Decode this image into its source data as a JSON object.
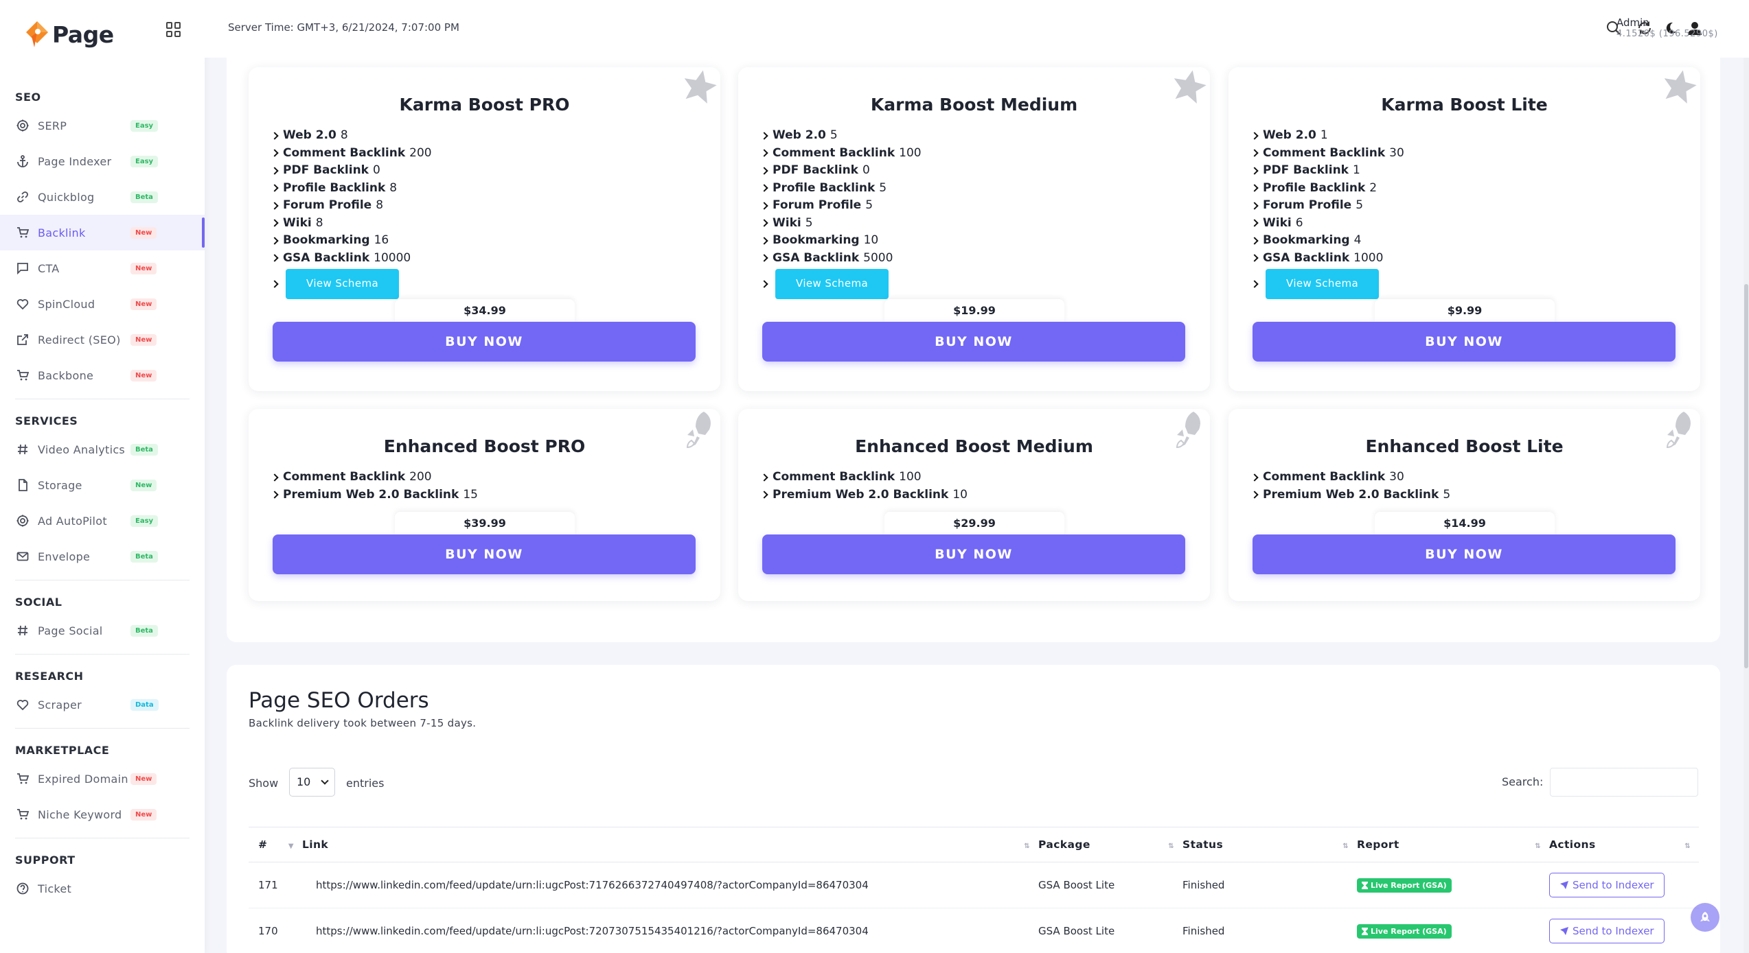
{
  "brand": {
    "name": "Page"
  },
  "header": {
    "server_time": "Server Time: GMT+3, 6/21/2024, 7:07:00 PM",
    "admin_name": "Admin",
    "admin_balance": "4.1520$ (196.5290$)"
  },
  "sidebar": {
    "sections": [
      {
        "title": "SEO",
        "items": [
          {
            "label": "SERP",
            "badge": "Easy",
            "badge_color": "green",
            "icon": "globe-icon"
          },
          {
            "label": "Page Indexer",
            "badge": "Easy",
            "badge_color": "green",
            "icon": "anchor-icon"
          },
          {
            "label": "Quickblog",
            "badge": "Beta",
            "badge_color": "green",
            "icon": "link-icon"
          },
          {
            "label": "Backlink",
            "badge": "New",
            "badge_color": "red",
            "icon": "cart-icon",
            "active": true
          },
          {
            "label": "CTA",
            "badge": "New",
            "badge_color": "red",
            "icon": "comment-icon"
          },
          {
            "label": "SpinCloud",
            "badge": "New",
            "badge_color": "red",
            "icon": "heart-icon"
          },
          {
            "label": "Redirect (SEO)",
            "badge": "New",
            "badge_color": "red",
            "icon": "external-link-icon"
          },
          {
            "label": "Backbone",
            "badge": "New",
            "badge_color": "red",
            "icon": "cart-icon"
          }
        ]
      },
      {
        "title": "SERVICES",
        "items": [
          {
            "label": "Video Analytics",
            "badge": "Beta",
            "badge_color": "green",
            "icon": "hash-icon"
          },
          {
            "label": "Storage",
            "badge": "New",
            "badge_color": "green",
            "icon": "file-icon"
          },
          {
            "label": "Ad AutoPilot",
            "badge": "Easy",
            "badge_color": "green",
            "icon": "globe-icon"
          },
          {
            "label": "Envelope",
            "badge": "Beta",
            "badge_color": "green",
            "icon": "mail-icon"
          }
        ]
      },
      {
        "title": "SOCIAL",
        "items": [
          {
            "label": "Page Social",
            "badge": "Beta",
            "badge_color": "green",
            "icon": "hash-icon"
          }
        ]
      },
      {
        "title": "RESEARCH",
        "items": [
          {
            "label": "Scraper",
            "badge": "Data",
            "badge_color": "blue",
            "icon": "heart-icon"
          }
        ]
      },
      {
        "title": "MARKETPLACE",
        "items": [
          {
            "label": "Expired Domain",
            "badge": "New",
            "badge_color": "red",
            "icon": "cart-icon"
          },
          {
            "label": "Niche Keyword",
            "badge": "New",
            "badge_color": "red",
            "icon": "cart-icon"
          }
        ]
      },
      {
        "title": "SUPPORT",
        "items": [
          {
            "label": "Ticket",
            "badge": "",
            "badge_color": "",
            "icon": "help-circle-icon"
          }
        ]
      }
    ]
  },
  "packages": [
    {
      "title": "Karma Boost PRO",
      "price": "$34.99",
      "schema": "View Schema",
      "corner": "star-icon",
      "features": [
        [
          "Web 2.0",
          "8"
        ],
        [
          "Comment Backlink",
          "200"
        ],
        [
          "PDF Backlink",
          "0"
        ],
        [
          "Profile Backlink",
          "8"
        ],
        [
          "Forum Profile",
          "8"
        ],
        [
          "Wiki",
          "8"
        ],
        [
          "Bookmarking",
          "16"
        ],
        [
          "GSA Backlink",
          "10000"
        ]
      ]
    },
    {
      "title": "Karma Boost Medium",
      "price": "$19.99",
      "schema": "View Schema",
      "corner": "star-icon",
      "features": [
        [
          "Web 2.0",
          "5"
        ],
        [
          "Comment Backlink",
          "100"
        ],
        [
          "PDF Backlink",
          "0"
        ],
        [
          "Profile Backlink",
          "5"
        ],
        [
          "Forum Profile",
          "5"
        ],
        [
          "Wiki",
          "5"
        ],
        [
          "Bookmarking",
          "10"
        ],
        [
          "GSA Backlink",
          "5000"
        ]
      ]
    },
    {
      "title": "Karma Boost Lite",
      "price": "$9.99",
      "schema": "View Schema",
      "corner": "star-icon",
      "features": [
        [
          "Web 2.0",
          "1"
        ],
        [
          "Comment Backlink",
          "30"
        ],
        [
          "PDF Backlink",
          "1"
        ],
        [
          "Profile Backlink",
          "2"
        ],
        [
          "Forum Profile",
          "5"
        ],
        [
          "Wiki",
          "6"
        ],
        [
          "Bookmarking",
          "4"
        ],
        [
          "GSA Backlink",
          "1000"
        ]
      ]
    },
    {
      "title": "Enhanced Boost PRO",
      "price": "$39.99",
      "schema": "",
      "corner": "rocket-icon",
      "features": [
        [
          "Comment Backlink",
          "200"
        ],
        [
          "Premium Web 2.0 Backlink",
          "15"
        ]
      ]
    },
    {
      "title": "Enhanced Boost Medium",
      "price": "$29.99",
      "schema": "",
      "corner": "rocket-icon",
      "features": [
        [
          "Comment Backlink",
          "100"
        ],
        [
          "Premium Web 2.0 Backlink",
          "10"
        ]
      ]
    },
    {
      "title": "Enhanced Boost Lite",
      "price": "$14.99",
      "schema": "",
      "corner": "rocket-icon",
      "features": [
        [
          "Comment Backlink",
          "30"
        ],
        [
          "Premium Web 2.0 Backlink",
          "5"
        ]
      ]
    }
  ],
  "buy_label": "BUY NOW",
  "orders": {
    "title": "Page SEO Orders",
    "subtitle": "Backlink delivery took between 7-15 days.",
    "show_label": "Show",
    "entries_value": "10",
    "entries_label": "entries",
    "search_label": "Search:",
    "columns": [
      "#",
      "Link",
      "Package",
      "Status",
      "Report",
      "Actions"
    ],
    "rows": [
      {
        "id": "171",
        "link": "https://www.linkedin.com/feed/update/urn:li:ugcPost:7176266372740497408/?actorCompanyId=86470304",
        "package": "GSA Boost Lite",
        "status": "Finished",
        "report": "Live Report (GSA)",
        "action": "Send to Indexer"
      },
      {
        "id": "170",
        "link": "https://www.linkedin.com/feed/update/urn:li:ugcPost:7207307515435401216/?actorCompanyId=86470304",
        "package": "GSA Boost Lite",
        "status": "Finished",
        "report": "Live Report (GSA)",
        "action": "Send to Indexer"
      }
    ]
  },
  "colors": {
    "accent": "#7367f0",
    "buy": "#7268f5",
    "schema": "#1ec8f3",
    "live": "#28c76f"
  }
}
